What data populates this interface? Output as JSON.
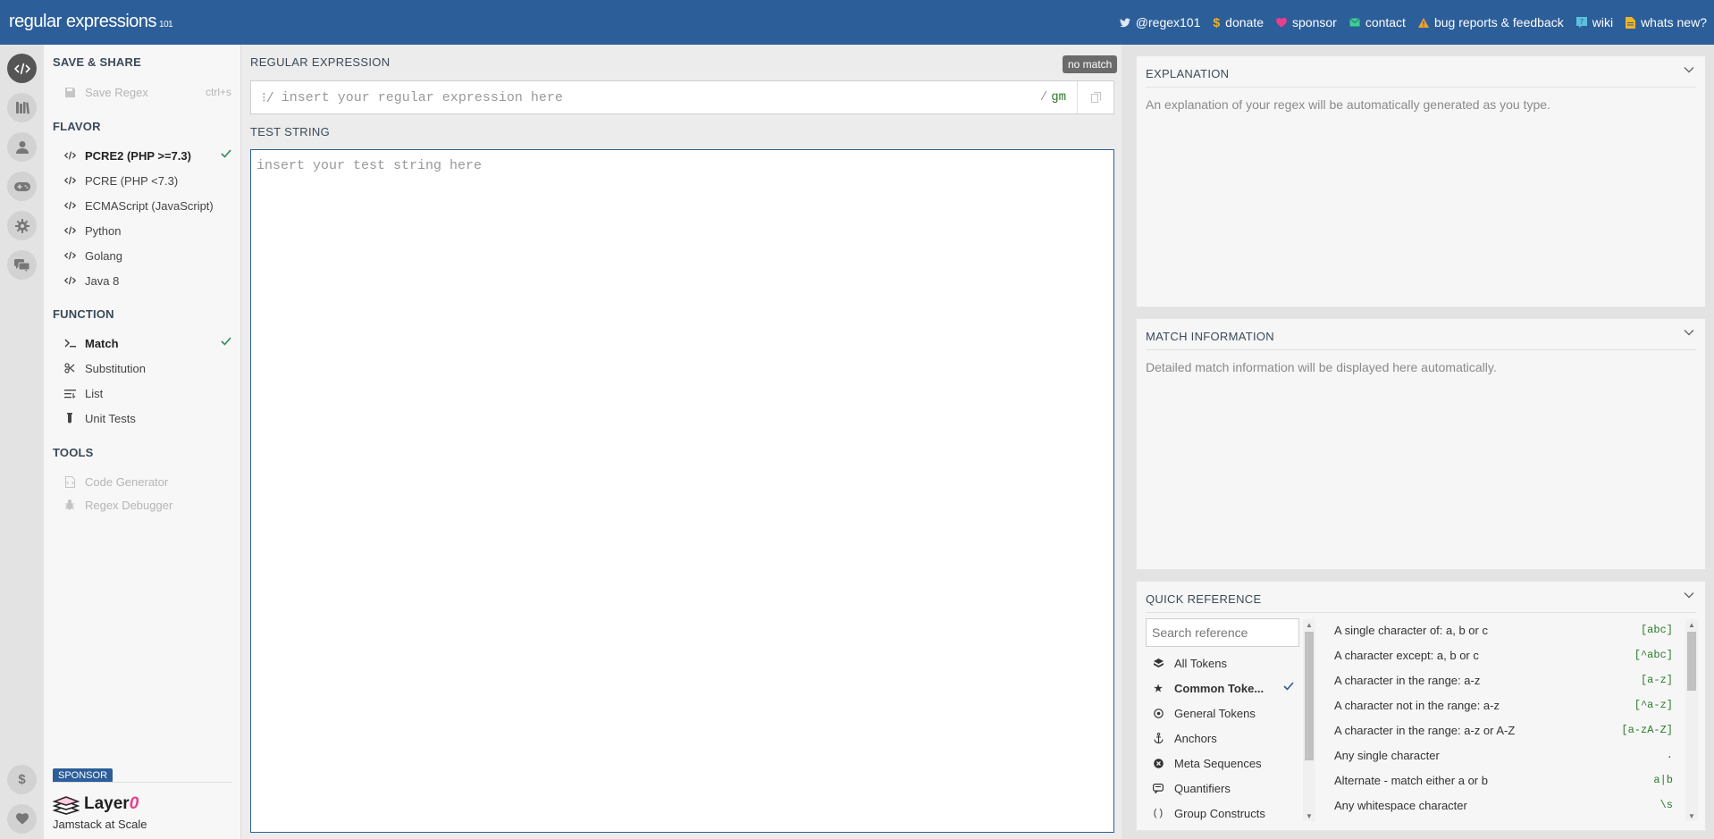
{
  "header": {
    "logo_text": "regular expressions",
    "logo_suffix": "101",
    "nav": [
      {
        "label": "@regex101",
        "icon": "twitter-icon"
      },
      {
        "label": "donate",
        "icon": "dollar-icon"
      },
      {
        "label": "sponsor",
        "icon": "heart-icon"
      },
      {
        "label": "contact",
        "icon": "envelope-icon"
      },
      {
        "label": "bug reports & feedback",
        "icon": "warning-icon"
      },
      {
        "label": "wiki",
        "icon": "wiki-icon"
      },
      {
        "label": "whats new?",
        "icon": "document-icon"
      }
    ]
  },
  "rail": {
    "top": [
      "code-icon",
      "library-icon",
      "user-icon",
      "gamepad-icon",
      "settings-icon",
      "chat-icon"
    ],
    "bottom": [
      "dollar-icon",
      "heart-icon"
    ]
  },
  "sidebar": {
    "save_share": {
      "heading": "SAVE & SHARE",
      "save_label": "Save Regex",
      "save_shortcut": "ctrl+s"
    },
    "flavor": {
      "heading": "FLAVOR",
      "items": [
        {
          "label": "PCRE2 (PHP >=7.3)",
          "selected": true
        },
        {
          "label": "PCRE (PHP <7.3)"
        },
        {
          "label": "ECMAScript (JavaScript)"
        },
        {
          "label": "Python"
        },
        {
          "label": "Golang"
        },
        {
          "label": "Java 8"
        }
      ]
    },
    "function": {
      "heading": "FUNCTION",
      "items": [
        {
          "label": "Match",
          "icon": "terminal-icon",
          "selected": true
        },
        {
          "label": "Substitution",
          "icon": "scissors-icon"
        },
        {
          "label": "List",
          "icon": "list-icon"
        },
        {
          "label": "Unit Tests",
          "icon": "flask-icon"
        }
      ]
    },
    "tools": {
      "heading": "TOOLS",
      "items": [
        {
          "label": "Code Generator",
          "icon": "file-code-icon"
        },
        {
          "label": "Regex Debugger",
          "icon": "bug-icon"
        }
      ]
    },
    "sponsor": {
      "badge": "SPONSOR",
      "name": "Layer",
      "name_accent": "0",
      "tagline": "Jamstack at Scale"
    }
  },
  "editor": {
    "regex_title": "REGULAR EXPRESSION",
    "status": "no match",
    "delimiter_left": "⁝/",
    "regex_placeholder": "insert your regular expression here",
    "delimiter_right": "/",
    "flags": "gm",
    "test_title": "TEST STRING",
    "test_placeholder": "insert your test string here"
  },
  "explanation": {
    "title": "EXPLANATION",
    "text": "An explanation of your regex will be automatically generated as you type."
  },
  "match_info": {
    "title": "MATCH INFORMATION",
    "text": "Detailed match information will be displayed here automatically."
  },
  "quick_reference": {
    "title": "QUICK REFERENCE",
    "search_placeholder": "Search reference",
    "categories": [
      {
        "label": "All Tokens",
        "icon": "stack-icon"
      },
      {
        "label": "Common Toke...",
        "icon": "star-icon",
        "selected": true
      },
      {
        "label": "General Tokens",
        "icon": "dot-circle-icon"
      },
      {
        "label": "Anchors",
        "icon": "anchor-icon"
      },
      {
        "label": "Meta Sequences",
        "icon": "x-circle-icon"
      },
      {
        "label": "Quantifiers",
        "icon": "quantifier-icon"
      },
      {
        "label": "Group Constructs",
        "icon": "parentheses-icon"
      }
    ],
    "rows": [
      {
        "desc": "A single character of: a, b or c",
        "token": "[abc]"
      },
      {
        "desc": "A character except: a, b or c",
        "token": "[^abc]"
      },
      {
        "desc": "A character in the range: a-z",
        "token": "[a-z]"
      },
      {
        "desc": "A character not in the range: a-z",
        "token": "[^a-z]"
      },
      {
        "desc": "A character in the range: a-z or A-Z",
        "token": "[a-zA-Z]"
      },
      {
        "desc": "Any single character",
        "token": "."
      },
      {
        "desc": "Alternate - match either a or b",
        "token": "a|b"
      },
      {
        "desc": "Any whitespace character",
        "token": "\\s"
      }
    ]
  },
  "colors": {
    "header_bg": "#2c5e99",
    "token_green": "#2a7a2a",
    "check_green": "#2e8b57"
  }
}
